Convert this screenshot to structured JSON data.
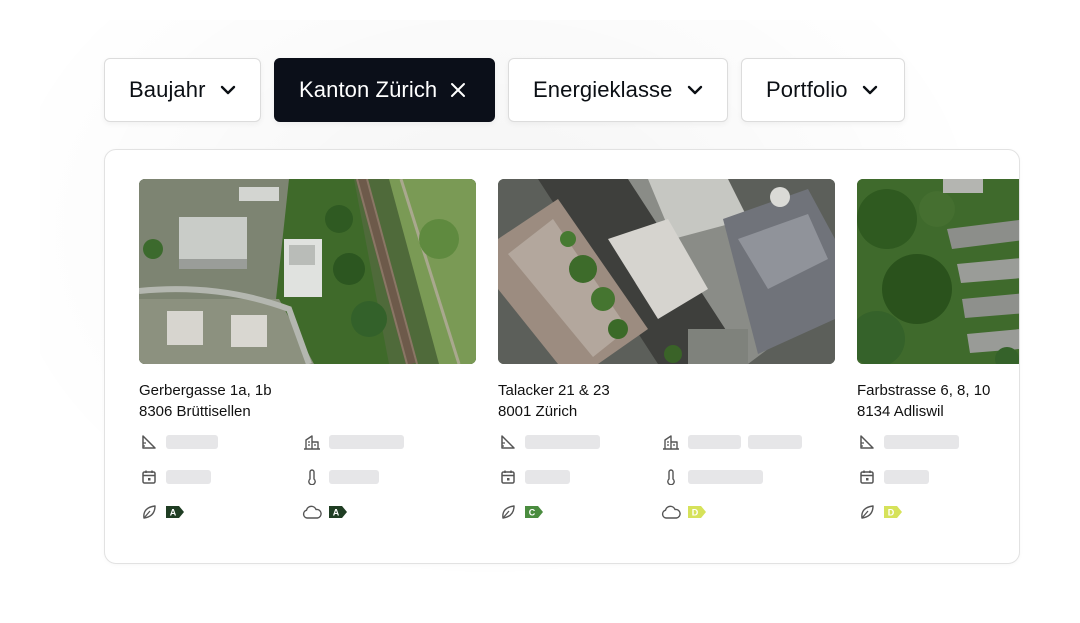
{
  "filters": [
    {
      "label": "Baujahr",
      "icon": "chevron-down-icon",
      "active": false
    },
    {
      "label": "Kanton Zürich",
      "icon": "close-icon",
      "active": true
    },
    {
      "label": "Energieklasse",
      "icon": "chevron-down-icon",
      "active": false
    },
    {
      "label": "Portfolio",
      "icon": "chevron-down-icon",
      "active": false
    }
  ],
  "properties": [
    {
      "street": "Gerbergasse 1a, 1b",
      "city": "8306 Brüttisellen",
      "energy_class": {
        "letter": "A",
        "color": "#1f3d23"
      },
      "co2_class": {
        "letter": "A",
        "color": "#1f3d23"
      }
    },
    {
      "street": "Talacker 21 & 23",
      "city": "8001 Zürich",
      "energy_class": {
        "letter": "C",
        "color": "#4a8c3f"
      },
      "co2_class": {
        "letter": "D",
        "color": "#d6e25a"
      }
    },
    {
      "street": "Farbstrasse 6, 8, 10",
      "city": "8134 Adliswil",
      "energy_class": {
        "letter": "D",
        "color": "#d6e25a"
      }
    }
  ],
  "meta_icons": [
    "area-icon",
    "building-icon",
    "calendar-icon",
    "thermometer-icon",
    "leaf-icon",
    "cloud-icon"
  ],
  "colors": {
    "active_chip": "#0b0f19",
    "skeleton": "#e6e6e8",
    "border": "#e2e2e2"
  }
}
